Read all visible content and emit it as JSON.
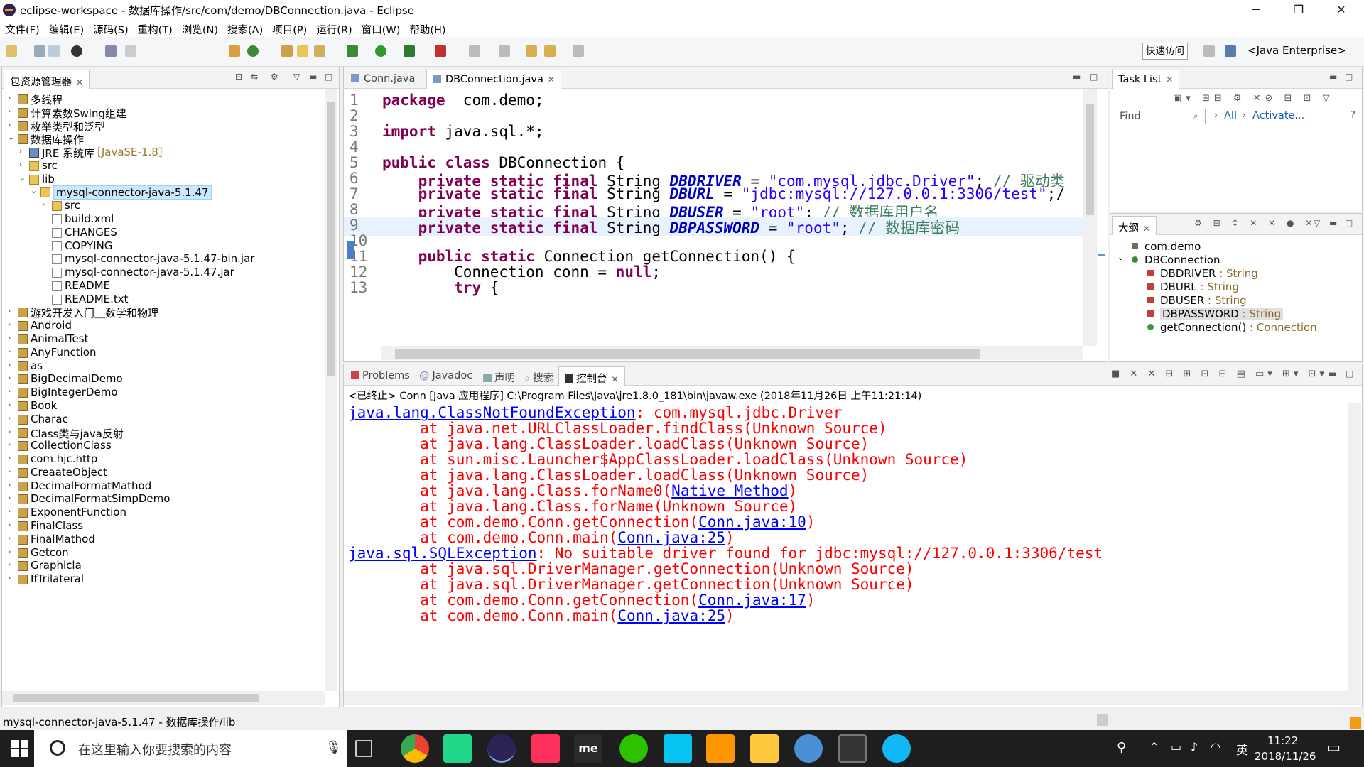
{
  "window": {
    "title": "eclipse-workspace - 数据库操作/src/com/demo/DBConnection.java - Eclipse",
    "minimize": "─",
    "restore": "❐",
    "close": "✕"
  },
  "menu": [
    "文件(F)",
    "编辑(E)",
    "源码(S)",
    "重构(T)",
    "浏览(N)",
    "搜索(A)",
    "项目(P)",
    "运行(R)",
    "窗口(W)",
    "帮助(H)"
  ],
  "toolbar": {
    "quick_access": "快速访问",
    "perspective": "<Java Enterprise>"
  },
  "package_explorer": {
    "tab_label": "包资源管理器",
    "tree": [
      {
        "label": "多线程",
        "depth": 0,
        "kind": "proj",
        "arrow": "›"
      },
      {
        "label": "计算素数Swing组建",
        "depth": 0,
        "kind": "proj",
        "arrow": "›"
      },
      {
        "label": "枚举类型和泛型",
        "depth": 0,
        "kind": "proj",
        "arrow": "›"
      },
      {
        "label": "数据库操作",
        "depth": 0,
        "kind": "proj",
        "arrow": "⌄"
      },
      {
        "label": "JRE 系统库",
        "suffix": " [JavaSE-1.8]",
        "depth": 1,
        "kind": "lib",
        "arrow": "›"
      },
      {
        "label": "src",
        "depth": 1,
        "kind": "folder",
        "arrow": "›"
      },
      {
        "label": "lib",
        "depth": 1,
        "kind": "folder",
        "arrow": "⌄"
      },
      {
        "label": "mysql-connector-java-5.1.47",
        "depth": 2,
        "kind": "folder",
        "arrow": "⌄",
        "selected": true
      },
      {
        "label": "src",
        "depth": 3,
        "kind": "folder",
        "arrow": "›"
      },
      {
        "label": "build.xml",
        "depth": 3,
        "kind": "file",
        "arrow": ""
      },
      {
        "label": "CHANGES",
        "depth": 3,
        "kind": "file",
        "arrow": ""
      },
      {
        "label": "COPYING",
        "depth": 3,
        "kind": "file",
        "arrow": ""
      },
      {
        "label": "mysql-connector-java-5.1.47-bin.jar",
        "depth": 3,
        "kind": "file",
        "arrow": ""
      },
      {
        "label": "mysql-connector-java-5.1.47.jar",
        "depth": 3,
        "kind": "file",
        "arrow": ""
      },
      {
        "label": "README",
        "depth": 3,
        "kind": "file",
        "arrow": ""
      },
      {
        "label": "README.txt",
        "depth": 3,
        "kind": "file",
        "arrow": ""
      },
      {
        "label": "游戏开发入门＿数学和物理",
        "depth": 0,
        "kind": "proj",
        "arrow": "›"
      },
      {
        "label": "Android",
        "depth": 0,
        "kind": "proj",
        "arrow": "›"
      },
      {
        "label": "AnimalTest",
        "depth": 0,
        "kind": "proj",
        "arrow": "›"
      },
      {
        "label": "AnyFunction",
        "depth": 0,
        "kind": "proj",
        "arrow": "›"
      },
      {
        "label": "as",
        "depth": 0,
        "kind": "proj",
        "arrow": "›"
      },
      {
        "label": "BigDecimalDemo",
        "depth": 0,
        "kind": "proj",
        "arrow": "›"
      },
      {
        "label": "BigIntegerDemo",
        "depth": 0,
        "kind": "proj",
        "arrow": "›"
      },
      {
        "label": "Book",
        "depth": 0,
        "kind": "proj",
        "arrow": "›"
      },
      {
        "label": "Charac",
        "depth": 0,
        "kind": "proj",
        "arrow": "›"
      },
      {
        "label": "Class类与java反射",
        "depth": 0,
        "kind": "proj",
        "arrow": "›"
      },
      {
        "label": "CollectionClass",
        "depth": 0,
        "kind": "proj",
        "arrow": "›"
      },
      {
        "label": "com.hjc.http",
        "depth": 0,
        "kind": "proj",
        "arrow": "›"
      },
      {
        "label": "CreaateObject",
        "depth": 0,
        "kind": "proj",
        "arrow": "›"
      },
      {
        "label": "DecimalFormatMathod",
        "depth": 0,
        "kind": "proj",
        "arrow": "›"
      },
      {
        "label": "DecimalFormatSimpDemo",
        "depth": 0,
        "kind": "proj",
        "arrow": "›"
      },
      {
        "label": "ExponentFunction",
        "depth": 0,
        "kind": "proj",
        "arrow": "›"
      },
      {
        "label": "FinalClass",
        "depth": 0,
        "kind": "proj",
        "arrow": "›"
      },
      {
        "label": "FinalMathod",
        "depth": 0,
        "kind": "proj",
        "arrow": "›"
      },
      {
        "label": "Getcon",
        "depth": 0,
        "kind": "proj",
        "arrow": "›"
      },
      {
        "label": "Graphicla",
        "depth": 0,
        "kind": "proj",
        "arrow": "›"
      },
      {
        "label": "IfTrilateral",
        "depth": 0,
        "kind": "proj",
        "arrow": "›"
      }
    ]
  },
  "editor": {
    "tabs": [
      "Conn.java",
      "DBConnection.java"
    ],
    "active_tab": 1,
    "highlight_line": 9,
    "lines": [
      {
        "n": "1",
        "parts": [
          [
            "kw",
            "package"
          ],
          [
            "",
            "  com.demo;"
          ]
        ]
      },
      {
        "n": "2",
        "parts": []
      },
      {
        "n": "3",
        "parts": [
          [
            "kw",
            "import"
          ],
          [
            "",
            " java.sql.*;"
          ]
        ]
      },
      {
        "n": "4",
        "parts": []
      },
      {
        "n": "5",
        "parts": [
          [
            "kw",
            "public"
          ],
          [
            "",
            " "
          ],
          [
            "kw",
            "class"
          ],
          [
            "",
            " DBConnection {"
          ]
        ]
      },
      {
        "n": "6",
        "parts": [
          [
            "",
            "    "
          ],
          [
            "kw",
            "private"
          ],
          [
            "",
            " "
          ],
          [
            "kw",
            "static"
          ],
          [
            "",
            " "
          ],
          [
            "kw",
            "final"
          ],
          [
            "",
            " String "
          ],
          [
            "fld",
            "DBDRIVER"
          ],
          [
            "",
            " = "
          ],
          [
            "str",
            "\"com.mysql.jdbc.Driver\""
          ],
          [
            "",
            "; "
          ],
          [
            "cmt",
            "// 驱动类"
          ]
        ]
      },
      {
        "n": "7",
        "parts": [
          [
            "",
            "    "
          ],
          [
            "kw",
            "private"
          ],
          [
            "",
            " "
          ],
          [
            "kw",
            "static"
          ],
          [
            "",
            " "
          ],
          [
            "kw",
            "final"
          ],
          [
            "",
            " String "
          ],
          [
            "fld",
            "DBURL"
          ],
          [
            "",
            " = "
          ],
          [
            "str",
            "\"jdbc:mysql://127.0.0.1:3306/test\""
          ],
          [
            "",
            ";/"
          ]
        ]
      },
      {
        "n": "8",
        "parts": [
          [
            "",
            "    "
          ],
          [
            "kw",
            "private"
          ],
          [
            "",
            " "
          ],
          [
            "kw",
            "static"
          ],
          [
            "",
            " "
          ],
          [
            "kw",
            "final"
          ],
          [
            "",
            " String "
          ],
          [
            "fld",
            "DBUSER"
          ],
          [
            "",
            " = "
          ],
          [
            "str",
            "\"root\""
          ],
          [
            "",
            "; "
          ],
          [
            "cmt",
            "// 数据库用户名"
          ]
        ]
      },
      {
        "n": "9",
        "parts": [
          [
            "",
            "    "
          ],
          [
            "kw",
            "private"
          ],
          [
            "",
            " "
          ],
          [
            "kw",
            "static"
          ],
          [
            "",
            " "
          ],
          [
            "kw",
            "final"
          ],
          [
            "",
            " String "
          ],
          [
            "fld",
            "DBPASSWORD"
          ],
          [
            "",
            " = "
          ],
          [
            "str",
            "\"root\""
          ],
          [
            "",
            "; "
          ],
          [
            "cmt",
            "// 数据库密码"
          ]
        ]
      },
      {
        "n": "10",
        "parts": []
      },
      {
        "n": "11",
        "parts": [
          [
            "",
            "    "
          ],
          [
            "kw",
            "public"
          ],
          [
            "",
            " "
          ],
          [
            "kw",
            "static"
          ],
          [
            "",
            " Connection getConnection() {"
          ]
        ]
      },
      {
        "n": "12",
        "parts": [
          [
            "",
            "        Connection conn = "
          ],
          [
            "kw",
            "null"
          ],
          [
            "",
            ";"
          ]
        ]
      },
      {
        "n": "13",
        "parts": [
          [
            "",
            "        "
          ],
          [
            "kw",
            "try"
          ],
          [
            "",
            " {"
          ]
        ]
      }
    ]
  },
  "task_list": {
    "tab_label": "Task List",
    "find_placeholder": "Find",
    "all_label": "All",
    "activate_label": "Activate..."
  },
  "outline": {
    "tab_label": "大纲",
    "items": [
      {
        "label": "com.demo",
        "type": "",
        "depth": 0,
        "icon": "pkg"
      },
      {
        "label": "DBConnection",
        "type": "",
        "depth": 0,
        "icon": "class",
        "arrow": "⌄"
      },
      {
        "label": "DBDRIVER",
        "type": " : String",
        "depth": 1,
        "icon": "field"
      },
      {
        "label": "DBURL",
        "type": " : String",
        "depth": 1,
        "icon": "field"
      },
      {
        "label": "DBUSER",
        "type": " : String",
        "depth": 1,
        "icon": "field"
      },
      {
        "label": "DBPASSWORD",
        "type": " : String",
        "depth": 1,
        "icon": "field",
        "selected": true
      },
      {
        "label": "getConnection()",
        "type": " : Connection",
        "depth": 1,
        "icon": "method"
      }
    ]
  },
  "console": {
    "tabs": [
      "Problems",
      "Javadoc",
      "声明",
      "搜索",
      "控制台"
    ],
    "active_tab": 4,
    "header": "<已终止> Conn [Java 应用程序] C:\\Program Files\\Java\\jre1.8.0_181\\bin\\javaw.exe (2018年11月26日 上午11:21:14)",
    "lines": [
      {
        "indent": "",
        "parts": [
          [
            "lnk",
            "java.lang.ClassNotFoundException"
          ],
          [
            "",
            ": com.mysql.jdbc.Driver"
          ]
        ]
      },
      {
        "indent": "        ",
        "parts": [
          [
            "",
            "at java.net.URLClassLoader.findClass(Unknown Source)"
          ]
        ]
      },
      {
        "indent": "        ",
        "parts": [
          [
            "",
            "at java.lang.ClassLoader.loadClass(Unknown Source)"
          ]
        ]
      },
      {
        "indent": "        ",
        "parts": [
          [
            "",
            "at sun.misc.Launcher$AppClassLoader.loadClass(Unknown Source)"
          ]
        ]
      },
      {
        "indent": "        ",
        "parts": [
          [
            "",
            "at java.lang.ClassLoader.loadClass(Unknown Source)"
          ]
        ]
      },
      {
        "indent": "        ",
        "parts": [
          [
            "",
            "at java.lang.Class.forName0("
          ],
          [
            "lnk",
            "Native Method"
          ],
          [
            "",
            ")"
          ]
        ]
      },
      {
        "indent": "        ",
        "parts": [
          [
            "",
            "at java.lang.Class.forName(Unknown Source)"
          ]
        ]
      },
      {
        "indent": "        ",
        "parts": [
          [
            "",
            "at com.demo.Conn.getConnection("
          ],
          [
            "lnk",
            "Conn.java:10"
          ],
          [
            "",
            ")"
          ]
        ]
      },
      {
        "indent": "        ",
        "parts": [
          [
            "",
            "at com.demo.Conn.main("
          ],
          [
            "lnk",
            "Conn.java:25"
          ],
          [
            "",
            ")"
          ]
        ]
      },
      {
        "indent": "",
        "parts": [
          [
            "lnk",
            "java.sql.SQLException"
          ],
          [
            "",
            ": No suitable driver found for jdbc:mysql://127.0.0.1:3306/test"
          ]
        ]
      },
      {
        "indent": "        ",
        "parts": [
          [
            "",
            "at java.sql.DriverManager.getConnection(Unknown Source)"
          ]
        ]
      },
      {
        "indent": "        ",
        "parts": [
          [
            "",
            "at java.sql.DriverManager.getConnection(Unknown Source)"
          ]
        ]
      },
      {
        "indent": "        ",
        "parts": [
          [
            "",
            "at com.demo.Conn.getConnection("
          ],
          [
            "lnk",
            "Conn.java:17"
          ],
          [
            "",
            ")"
          ]
        ]
      },
      {
        "indent": "        ",
        "parts": [
          [
            "",
            "at com.demo.Conn.main("
          ],
          [
            "lnk",
            "Conn.java:25"
          ],
          [
            "",
            ")"
          ]
        ]
      }
    ]
  },
  "status_bar": {
    "text": "mysql-connector-java-5.1.47 - 数据库操作/lib"
  },
  "taskbar": {
    "search_placeholder": "在这里输入你要搜索的内容",
    "time": "11:22",
    "date": "2018/11/26",
    "ime": "英",
    "apps": [
      "task-view",
      "chrome",
      "pycharm",
      "eclipse",
      "intellij",
      "me",
      "wechat",
      "webstorm",
      "sublime",
      "explorer",
      "network-tool",
      "mysql",
      "qq"
    ]
  }
}
